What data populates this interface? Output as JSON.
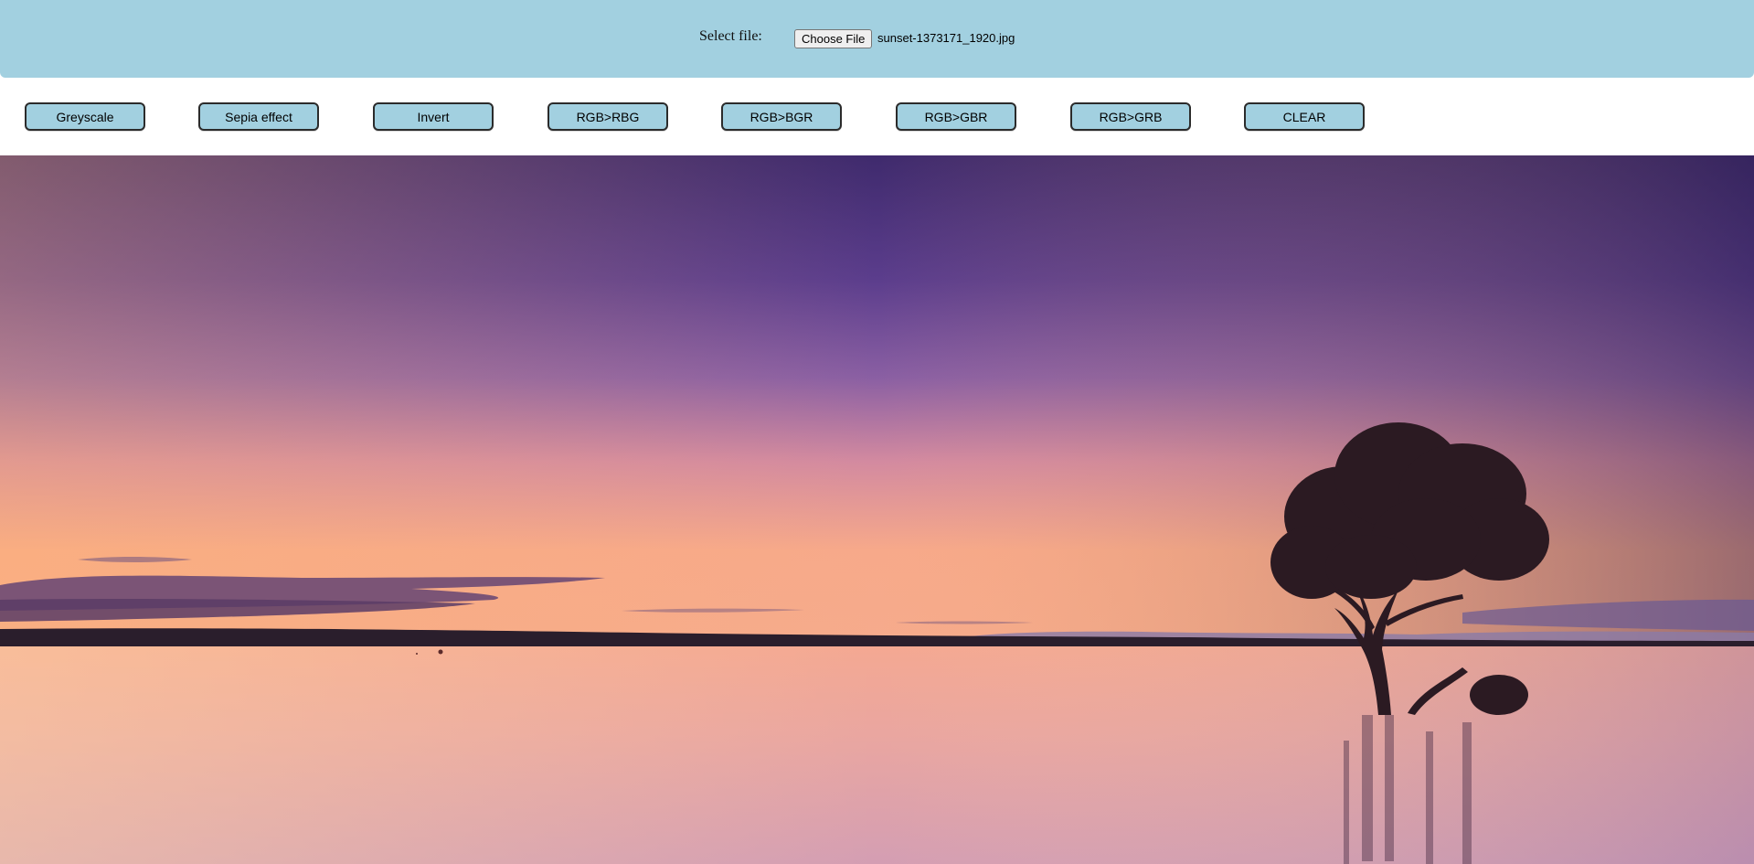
{
  "header": {
    "select_label": "Select file:",
    "choose_button_label": "Choose File",
    "file_name": "sunset-1373171_1920.jpg"
  },
  "toolbar": {
    "buttons": [
      {
        "label": "Greyscale"
      },
      {
        "label": "Sepia effect"
      },
      {
        "label": "Invert"
      },
      {
        "label": "RGB>RBG"
      },
      {
        "label": "RGB>BGR"
      },
      {
        "label": "RGB>GBR"
      },
      {
        "label": "RGB>GRB"
      },
      {
        "label": "CLEAR"
      }
    ]
  },
  "colors": {
    "accent": "#a2d0e0",
    "sky_top": "#4a2e78",
    "horizon": "#f7a98a",
    "water": "#f3b198"
  },
  "image": {
    "description_icon": "photo-canvas"
  }
}
